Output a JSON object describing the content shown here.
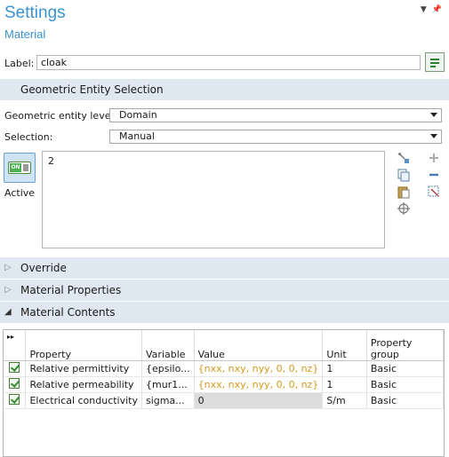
{
  "header": {
    "title": "Settings",
    "subtitle": "Material"
  },
  "label_field": {
    "label": "Label:",
    "value": "cloak"
  },
  "sections": {
    "geometric": "Geometric Entity Selection",
    "override": "Override",
    "material_properties": "Material Properties",
    "material_contents": "Material Contents"
  },
  "geometric": {
    "entity_level_label": "Geometric entity level:",
    "entity_level_value": "Domain",
    "selection_label": "Selection:",
    "selection_value": "Manual",
    "toggle_text": "ON",
    "active_label": "Active",
    "selected_items": [
      "2"
    ]
  },
  "table": {
    "columns": [
      "Property",
      "Variable",
      "Value",
      "Unit",
      "Property group"
    ],
    "rows": [
      {
        "property": "Relative permittivity",
        "variable": "{epsilo...",
        "value": "{nxx, nxy, nyy, 0, 0, nz}",
        "unit": "1",
        "group": "Basic"
      },
      {
        "property": "Relative permeability",
        "variable": "{mur1...",
        "value": "{nxx, nxy, nyy, 0, 0, nz}",
        "unit": "1",
        "group": "Basic"
      },
      {
        "property": "Electrical conductivity",
        "variable": "sigma...",
        "value": "0",
        "unit": "S/m",
        "group": "Basic"
      }
    ]
  },
  "colors": {
    "accent": "#3a93cf",
    "section_bg": "#dfe8f1",
    "value_highlight": "#d49a1c"
  }
}
